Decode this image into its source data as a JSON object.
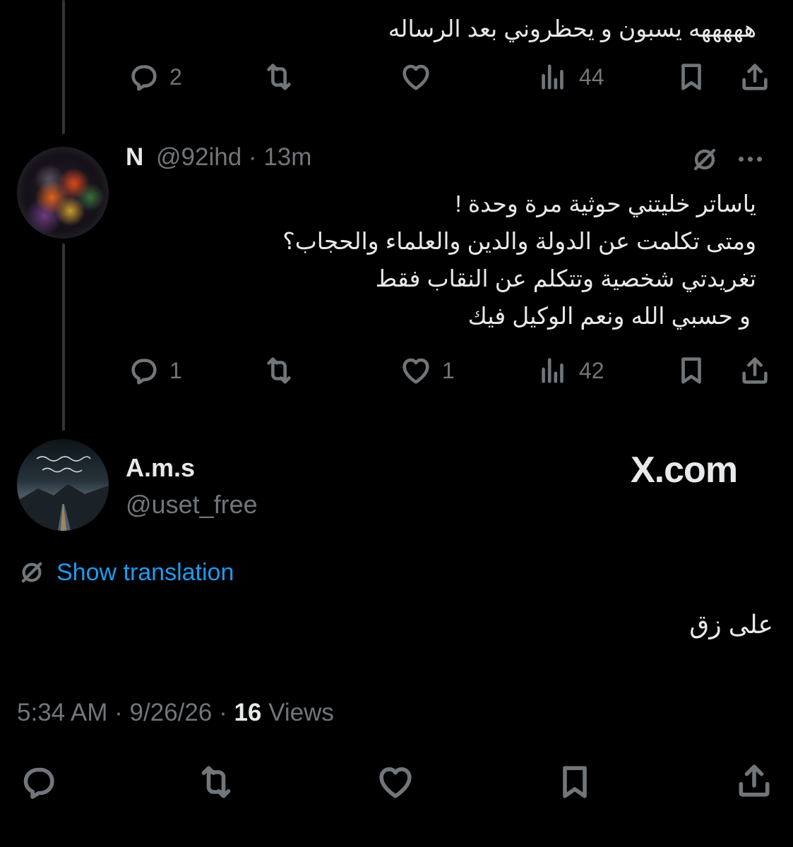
{
  "tweet1": {
    "text_line": "هههههه يسبون و يحظروني بعد الرساله",
    "actions": {
      "replies": "2",
      "reposts": "",
      "likes": "",
      "views": "44"
    }
  },
  "tweet2": {
    "name": "N",
    "handle": "@92ihd",
    "separator": "·",
    "time": "13m",
    "lines": [
      "ياساتر خليتني حوثية مرة وحدة !",
      "ومتى تكلمت عن الدولة والدين والعلماء والحجاب؟",
      "تغريدتي شخصية وتتكلم عن النقاب فقط",
      "و حسبي الله ونعم الوكيل فيك"
    ],
    "actions": {
      "replies": "1",
      "reposts": "",
      "likes": "1",
      "views": "42"
    }
  },
  "main_tweet": {
    "name": "A.m.s",
    "handle": "@uset_free",
    "brand": "X.com",
    "show_translation": "Show translation",
    "text": "على زق",
    "time": "5:34 AM",
    "sep1": "·",
    "date": "9/26/26",
    "sep2": "·",
    "views_count": "16",
    "views_label": "Views"
  },
  "colors": {
    "background": "#000000",
    "text": "#e7e9ea",
    "muted": "#71767b",
    "link": "#1d9bf0",
    "thread_line": "#333639"
  },
  "icons": [
    "reply-icon",
    "repost-icon",
    "like-icon",
    "views-icon",
    "bookmark-icon",
    "share-icon",
    "grok-icon",
    "more-icon",
    "translate-icon"
  ]
}
